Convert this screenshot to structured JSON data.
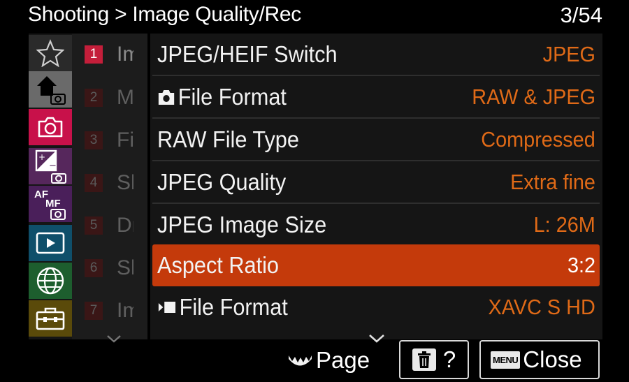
{
  "header": {
    "title": "Shooting > Image Quality/Rec",
    "page_count": "3/54"
  },
  "categories": [
    {
      "name": "star-icon",
      "selected": false,
      "color": "#2a2a2a"
    },
    {
      "name": "main-home-icon",
      "selected": false,
      "color": "#6a6a6a"
    },
    {
      "name": "shooting-camera-icon",
      "selected": true,
      "color": "#c8114a"
    },
    {
      "name": "exposure-color-icon",
      "selected": false,
      "color": "#56275c"
    },
    {
      "name": "focus-af-mf-icon",
      "selected": false,
      "color": "#4a1f5a"
    },
    {
      "name": "playback-icon",
      "selected": false,
      "color": "#0f4f6a"
    },
    {
      "name": "network-globe-icon",
      "selected": false,
      "color": "#1d5e2e"
    },
    {
      "name": "setup-toolbox-icon",
      "selected": false,
      "color": "#5a4a0a"
    }
  ],
  "sublist": [
    {
      "num": "1",
      "text": "Im",
      "active": true
    },
    {
      "num": "2",
      "text": "M",
      "active": false
    },
    {
      "num": "3",
      "text": "Fi",
      "active": false
    },
    {
      "num": "4",
      "text": "Sh",
      "active": false
    },
    {
      "num": "5",
      "text": "Dr",
      "active": false
    },
    {
      "num": "6",
      "text": "Sh",
      "active": false
    },
    {
      "num": "7",
      "text": "Im",
      "active": false
    }
  ],
  "rows": [
    {
      "label": "JPEG/HEIF Switch",
      "value": "JPEG",
      "icon": ""
    },
    {
      "label": "File Format",
      "value": "RAW & JPEG",
      "icon": "still-camera-icon"
    },
    {
      "label": "RAW File Type",
      "value": "Compressed",
      "icon": ""
    },
    {
      "label": "JPEG Quality",
      "value": "Extra fine",
      "icon": ""
    },
    {
      "label": "JPEG Image Size",
      "value": "L: 26M",
      "icon": ""
    },
    {
      "label": "Aspect Ratio",
      "value": "3:2",
      "icon": "",
      "selected": true
    },
    {
      "label": "File Format",
      "value": "XAVC S HD",
      "icon": "movie-icon"
    }
  ],
  "footer": {
    "page_label": "Page",
    "delete_help": "?",
    "menu_key": "MENU",
    "close_label": "Close"
  },
  "colors": {
    "accent_value": "#e06a17",
    "selected_row": "#c43a0b",
    "active_number": "#c41e3a"
  }
}
